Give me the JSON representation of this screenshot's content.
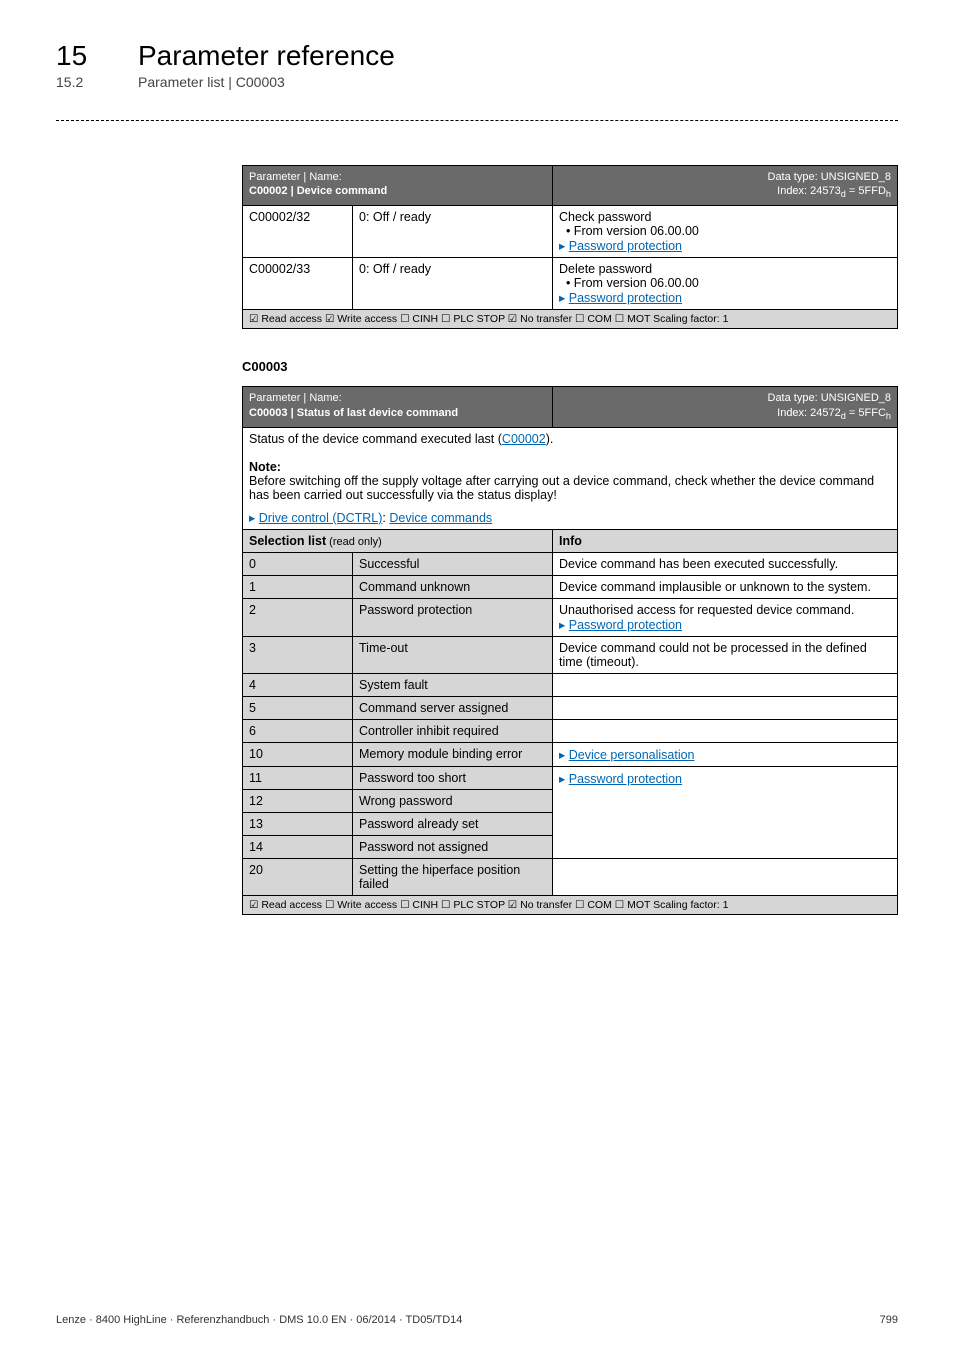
{
  "header": {
    "chapter_num": "15",
    "chapter_title": "Parameter reference",
    "section_num": "15.2",
    "section_title": "Parameter list | C00003"
  },
  "table1": {
    "header_left_line1": "Parameter | Name:",
    "header_left_line2_label": "C00002 | ",
    "header_left_line2_name": "Device command",
    "header_right_line1": "Data type: UNSIGNED_8",
    "header_right_line2": "Index: 24573",
    "header_right_line2_sub": "d",
    "header_right_line2_eq": " = 5FFD",
    "header_right_line2_sub2": "h",
    "rows": [
      {
        "c1": "C00002/32",
        "c2": "0: Off / ready",
        "c3_line1": "Check password",
        "c3_line2": "• From version 06.00.00",
        "c3_link": "Password protection"
      },
      {
        "c1": "C00002/33",
        "c2": "0: Off / ready",
        "c3_line1": "Delete password",
        "c3_line2": "• From version 06.00.00",
        "c3_link": "Password protection"
      }
    ],
    "footer": "☑ Read access   ☑ Write access   ☐ CINH   ☐ PLC STOP   ☑ No transfer   ☐ COM   ☐ MOT      Scaling factor: 1"
  },
  "subheading": "C00003",
  "table2": {
    "header_left_line1": "Parameter | Name:",
    "header_left_line2_label": "C00003 | ",
    "header_left_line2_name": "Status of last device command",
    "header_right_line1": "Data type: UNSIGNED_8",
    "header_right_line2": "Index: 24572",
    "header_right_line2_sub": "d",
    "header_right_line2_eq": " = 5FFC",
    "header_right_line2_sub2": "h",
    "status_text_pre": "Status of the device command executed last (",
    "status_link": "C00002",
    "status_text_post": ").",
    "note_title": "Note:",
    "note_body": "Before switching off the supply voltage after carrying out a device command, check whether the device command has been carried out successfully via the status display!",
    "note_link1": "Drive control (DCTRL)",
    "note_sep": ": ",
    "note_link2": "Device commands",
    "col1": "Selection list",
    "col1_suffix": " (read only)",
    "col2": "Info",
    "rows": [
      {
        "n": "0",
        "label": "Successful",
        "info": "Device command has been executed successfully."
      },
      {
        "n": "1",
        "label": "Command unknown",
        "info": "Device command implausible or unknown to the system."
      },
      {
        "n": "2",
        "label": "Password protection",
        "info_line1": "Unauthorised access for requested device command.",
        "info_link": "Password protection"
      },
      {
        "n": "3",
        "label": "Time-out",
        "info": "Device command could not be processed in the defined time (timeout)."
      },
      {
        "n": "4",
        "label": "System fault",
        "info": ""
      },
      {
        "n": "5",
        "label": "Command server assigned",
        "info": ""
      },
      {
        "n": "6",
        "label": "Controller inhibit required",
        "info": ""
      },
      {
        "n": "10",
        "label": "Memory module binding error",
        "info_link": "Device personalisation"
      },
      {
        "n": "11",
        "label": "Password too short",
        "info_link": "Password protection"
      },
      {
        "n": "12",
        "label": "Wrong password",
        "merged": true
      },
      {
        "n": "13",
        "label": "Password already set",
        "merged": true
      },
      {
        "n": "14",
        "label": "Password not assigned",
        "merged": true
      },
      {
        "n": "20",
        "label": "Setting the hiperface position failed",
        "info": ""
      }
    ],
    "footer": "☑ Read access   ☐ Write access   ☐ CINH   ☐ PLC STOP   ☑ No transfer   ☐ COM   ☐ MOT      Scaling factor: 1"
  },
  "footer": {
    "left": "Lenze · 8400 HighLine · Referenzhandbuch · DMS 10.0 EN · 06/2014 · TD05/TD14",
    "right": "799"
  }
}
